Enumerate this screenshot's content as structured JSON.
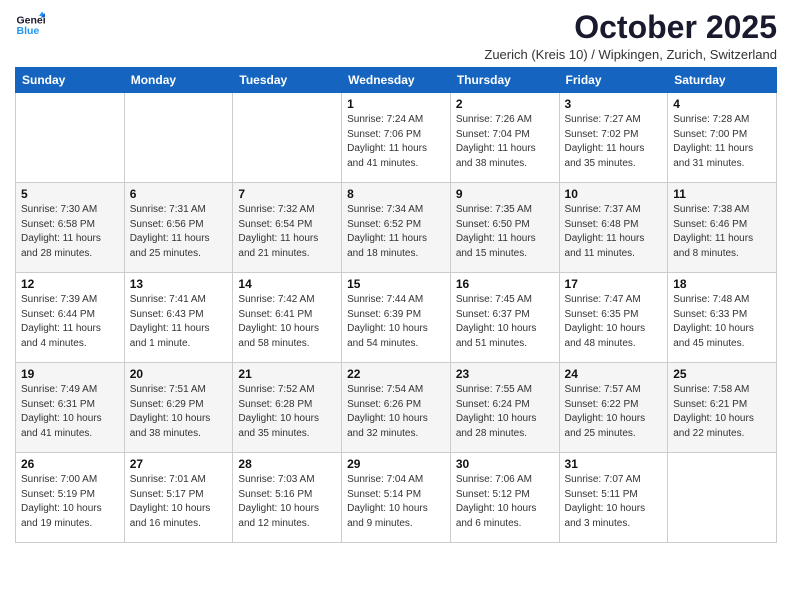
{
  "logo": {
    "line1": "General",
    "line2": "Blue"
  },
  "title": "October 2025",
  "subtitle": "Zuerich (Kreis 10) / Wipkingen, Zurich, Switzerland",
  "days": [
    "Sunday",
    "Monday",
    "Tuesday",
    "Wednesday",
    "Thursday",
    "Friday",
    "Saturday"
  ],
  "weeks": [
    [
      {
        "date": "",
        "sunrise": "",
        "sunset": "",
        "daylight": ""
      },
      {
        "date": "",
        "sunrise": "",
        "sunset": "",
        "daylight": ""
      },
      {
        "date": "",
        "sunrise": "",
        "sunset": "",
        "daylight": ""
      },
      {
        "date": "1",
        "sunrise": "Sunrise: 7:24 AM",
        "sunset": "Sunset: 7:06 PM",
        "daylight": "Daylight: 11 hours and 41 minutes."
      },
      {
        "date": "2",
        "sunrise": "Sunrise: 7:26 AM",
        "sunset": "Sunset: 7:04 PM",
        "daylight": "Daylight: 11 hours and 38 minutes."
      },
      {
        "date": "3",
        "sunrise": "Sunrise: 7:27 AM",
        "sunset": "Sunset: 7:02 PM",
        "daylight": "Daylight: 11 hours and 35 minutes."
      },
      {
        "date": "4",
        "sunrise": "Sunrise: 7:28 AM",
        "sunset": "Sunset: 7:00 PM",
        "daylight": "Daylight: 11 hours and 31 minutes."
      }
    ],
    [
      {
        "date": "5",
        "sunrise": "Sunrise: 7:30 AM",
        "sunset": "Sunset: 6:58 PM",
        "daylight": "Daylight: 11 hours and 28 minutes."
      },
      {
        "date": "6",
        "sunrise": "Sunrise: 7:31 AM",
        "sunset": "Sunset: 6:56 PM",
        "daylight": "Daylight: 11 hours and 25 minutes."
      },
      {
        "date": "7",
        "sunrise": "Sunrise: 7:32 AM",
        "sunset": "Sunset: 6:54 PM",
        "daylight": "Daylight: 11 hours and 21 minutes."
      },
      {
        "date": "8",
        "sunrise": "Sunrise: 7:34 AM",
        "sunset": "Sunset: 6:52 PM",
        "daylight": "Daylight: 11 hours and 18 minutes."
      },
      {
        "date": "9",
        "sunrise": "Sunrise: 7:35 AM",
        "sunset": "Sunset: 6:50 PM",
        "daylight": "Daylight: 11 hours and 15 minutes."
      },
      {
        "date": "10",
        "sunrise": "Sunrise: 7:37 AM",
        "sunset": "Sunset: 6:48 PM",
        "daylight": "Daylight: 11 hours and 11 minutes."
      },
      {
        "date": "11",
        "sunrise": "Sunrise: 7:38 AM",
        "sunset": "Sunset: 6:46 PM",
        "daylight": "Daylight: 11 hours and 8 minutes."
      }
    ],
    [
      {
        "date": "12",
        "sunrise": "Sunrise: 7:39 AM",
        "sunset": "Sunset: 6:44 PM",
        "daylight": "Daylight: 11 hours and 4 minutes."
      },
      {
        "date": "13",
        "sunrise": "Sunrise: 7:41 AM",
        "sunset": "Sunset: 6:43 PM",
        "daylight": "Daylight: 11 hours and 1 minute."
      },
      {
        "date": "14",
        "sunrise": "Sunrise: 7:42 AM",
        "sunset": "Sunset: 6:41 PM",
        "daylight": "Daylight: 10 hours and 58 minutes."
      },
      {
        "date": "15",
        "sunrise": "Sunrise: 7:44 AM",
        "sunset": "Sunset: 6:39 PM",
        "daylight": "Daylight: 10 hours and 54 minutes."
      },
      {
        "date": "16",
        "sunrise": "Sunrise: 7:45 AM",
        "sunset": "Sunset: 6:37 PM",
        "daylight": "Daylight: 10 hours and 51 minutes."
      },
      {
        "date": "17",
        "sunrise": "Sunrise: 7:47 AM",
        "sunset": "Sunset: 6:35 PM",
        "daylight": "Daylight: 10 hours and 48 minutes."
      },
      {
        "date": "18",
        "sunrise": "Sunrise: 7:48 AM",
        "sunset": "Sunset: 6:33 PM",
        "daylight": "Daylight: 10 hours and 45 minutes."
      }
    ],
    [
      {
        "date": "19",
        "sunrise": "Sunrise: 7:49 AM",
        "sunset": "Sunset: 6:31 PM",
        "daylight": "Daylight: 10 hours and 41 minutes."
      },
      {
        "date": "20",
        "sunrise": "Sunrise: 7:51 AM",
        "sunset": "Sunset: 6:29 PM",
        "daylight": "Daylight: 10 hours and 38 minutes."
      },
      {
        "date": "21",
        "sunrise": "Sunrise: 7:52 AM",
        "sunset": "Sunset: 6:28 PM",
        "daylight": "Daylight: 10 hours and 35 minutes."
      },
      {
        "date": "22",
        "sunrise": "Sunrise: 7:54 AM",
        "sunset": "Sunset: 6:26 PM",
        "daylight": "Daylight: 10 hours and 32 minutes."
      },
      {
        "date": "23",
        "sunrise": "Sunrise: 7:55 AM",
        "sunset": "Sunset: 6:24 PM",
        "daylight": "Daylight: 10 hours and 28 minutes."
      },
      {
        "date": "24",
        "sunrise": "Sunrise: 7:57 AM",
        "sunset": "Sunset: 6:22 PM",
        "daylight": "Daylight: 10 hours and 25 minutes."
      },
      {
        "date": "25",
        "sunrise": "Sunrise: 7:58 AM",
        "sunset": "Sunset: 6:21 PM",
        "daylight": "Daylight: 10 hours and 22 minutes."
      }
    ],
    [
      {
        "date": "26",
        "sunrise": "Sunrise: 7:00 AM",
        "sunset": "Sunset: 5:19 PM",
        "daylight": "Daylight: 10 hours and 19 minutes."
      },
      {
        "date": "27",
        "sunrise": "Sunrise: 7:01 AM",
        "sunset": "Sunset: 5:17 PM",
        "daylight": "Daylight: 10 hours and 16 minutes."
      },
      {
        "date": "28",
        "sunrise": "Sunrise: 7:03 AM",
        "sunset": "Sunset: 5:16 PM",
        "daylight": "Daylight: 10 hours and 12 minutes."
      },
      {
        "date": "29",
        "sunrise": "Sunrise: 7:04 AM",
        "sunset": "Sunset: 5:14 PM",
        "daylight": "Daylight: 10 hours and 9 minutes."
      },
      {
        "date": "30",
        "sunrise": "Sunrise: 7:06 AM",
        "sunset": "Sunset: 5:12 PM",
        "daylight": "Daylight: 10 hours and 6 minutes."
      },
      {
        "date": "31",
        "sunrise": "Sunrise: 7:07 AM",
        "sunset": "Sunset: 5:11 PM",
        "daylight": "Daylight: 10 hours and 3 minutes."
      },
      {
        "date": "",
        "sunrise": "",
        "sunset": "",
        "daylight": ""
      }
    ]
  ]
}
